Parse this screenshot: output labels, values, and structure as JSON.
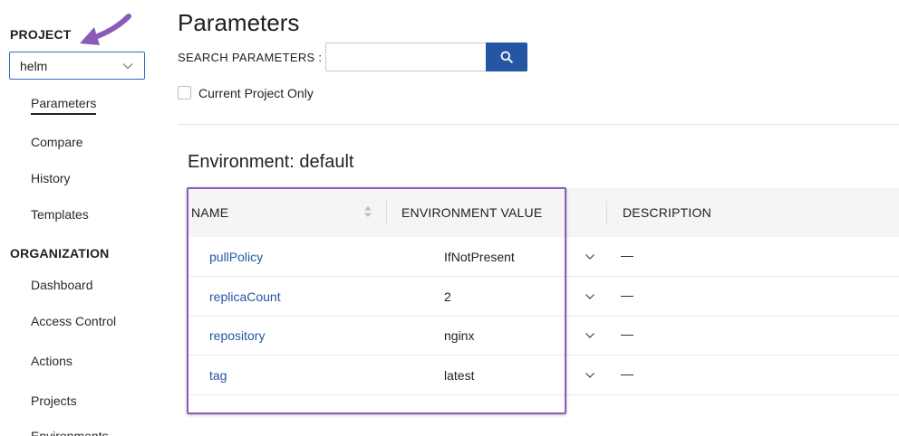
{
  "sidebar": {
    "project_title": "PROJECT",
    "project_select": {
      "value": "helm"
    },
    "project_items": [
      {
        "label": "Parameters",
        "active": true
      },
      {
        "label": "Compare"
      },
      {
        "label": "History"
      },
      {
        "label": "Templates"
      }
    ],
    "org_title": "ORGANIZATION",
    "org_items": [
      {
        "label": "Dashboard"
      },
      {
        "label": "Access Control"
      },
      {
        "label": "Actions"
      },
      {
        "label": "Projects"
      },
      {
        "label": "Environments"
      }
    ]
  },
  "main": {
    "title": "Parameters",
    "search": {
      "label": "SEARCH PARAMETERS :",
      "value": "",
      "placeholder": ""
    },
    "current_project_only": {
      "label": "Current Project Only",
      "checked": false
    },
    "environment_title": "Environment: default",
    "table": {
      "columns": [
        "NAME",
        "ENVIRONMENT VALUE",
        "DESCRIPTION"
      ],
      "rows": [
        {
          "name": "pullPolicy",
          "value": "IfNotPresent",
          "description": "—"
        },
        {
          "name": "replicaCount",
          "value": "2",
          "description": "—"
        },
        {
          "name": "repository",
          "value": "nginx",
          "description": "—"
        },
        {
          "name": "tag",
          "value": "latest",
          "description": "—"
        }
      ]
    }
  },
  "colors": {
    "accent": "#2456a4",
    "link": "#2456a4",
    "annotation": "#8a5cb5"
  },
  "icons": {
    "search": "search-icon",
    "chevron": "chevron-down-icon",
    "sort": "sort-icon",
    "annotation_arrow": "arrow-icon"
  }
}
